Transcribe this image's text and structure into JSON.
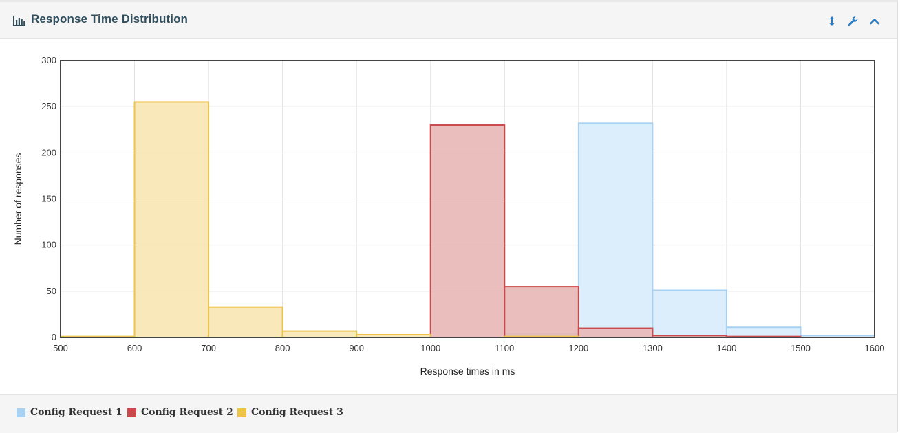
{
  "panel": {
    "title": "Response Time Distribution",
    "icons": [
      "bar-chart-icon",
      "resize-vertical-icon",
      "wrench-icon",
      "chevron-up-icon"
    ]
  },
  "colors": {
    "series1_fill": "#dcedfb",
    "series1_stroke": "#a8d1f2",
    "series2_fill": "#e8b7b6",
    "series2_stroke": "#c9494c",
    "series3_fill": "#f8e5b2",
    "series3_stroke": "#ecc44a",
    "grid": "#e0e0e0",
    "frame": "#444444"
  },
  "chart_data": {
    "type": "bar",
    "title": "",
    "xlabel": "Response times in ms",
    "ylabel": "Number of responses",
    "xlim": [
      500,
      1600
    ],
    "ylim": [
      0,
      300
    ],
    "x_ticks": [
      500,
      600,
      700,
      800,
      900,
      1000,
      1100,
      1200,
      1300,
      1400,
      1500,
      1600
    ],
    "y_ticks": [
      0,
      50,
      100,
      150,
      200,
      250,
      300
    ],
    "bin_width": 100,
    "grid": true,
    "legend_position": "bottom-left",
    "series": [
      {
        "name": "Config Request 1",
        "bins": [
          {
            "start": 1100,
            "value": 4
          },
          {
            "start": 1200,
            "value": 232
          },
          {
            "start": 1300,
            "value": 51
          },
          {
            "start": 1400,
            "value": 11
          },
          {
            "start": 1500,
            "value": 2
          }
        ]
      },
      {
        "name": "Config Request 2",
        "bins": [
          {
            "start": 1000,
            "value": 230
          },
          {
            "start": 1100,
            "value": 55
          },
          {
            "start": 1200,
            "value": 10
          },
          {
            "start": 1300,
            "value": 2
          },
          {
            "start": 1400,
            "value": 1
          }
        ]
      },
      {
        "name": "Config Request 3",
        "bins": [
          {
            "start": 500,
            "value": 1
          },
          {
            "start": 600,
            "value": 255
          },
          {
            "start": 700,
            "value": 33
          },
          {
            "start": 800,
            "value": 7
          },
          {
            "start": 900,
            "value": 3
          },
          {
            "start": 1100,
            "value": 1
          }
        ]
      }
    ]
  }
}
